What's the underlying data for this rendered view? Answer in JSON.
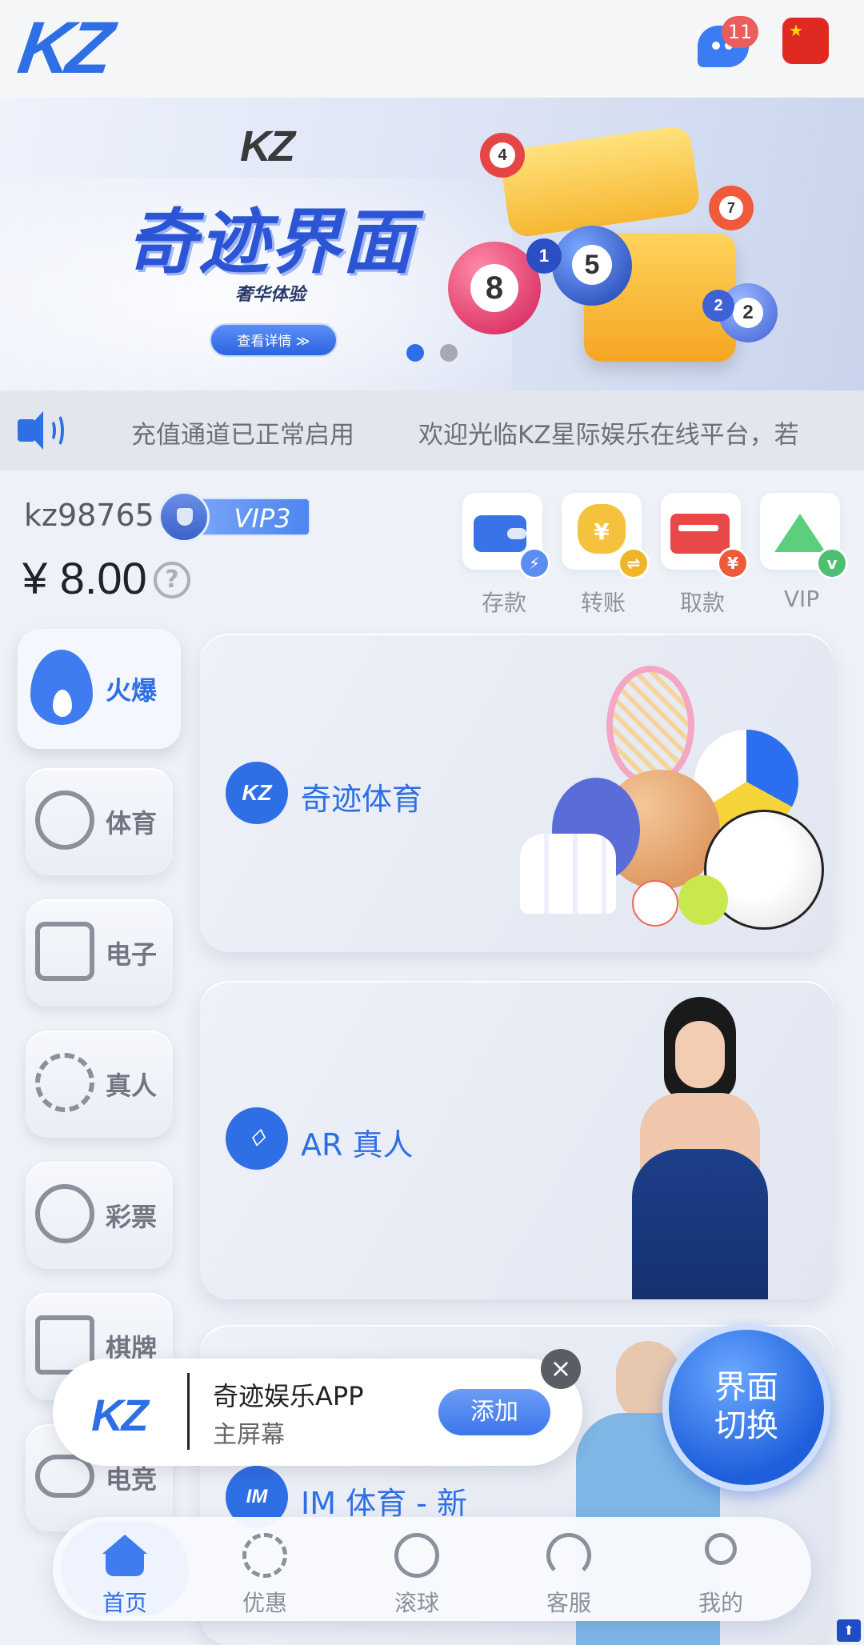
{
  "header": {
    "logo": "KZ",
    "message_count": "11",
    "language_flag": "china-flag-icon"
  },
  "banner": {
    "brand": "KZ",
    "title": "奇迹界面",
    "subtitle": "奢华体验",
    "button_label": "查看详情 ≫",
    "ball_numbers": [
      "4",
      "8",
      "5",
      "1",
      "2",
      "2",
      "7"
    ],
    "slides": 2,
    "active_slide": 1
  },
  "marquee": {
    "items": [
      "充值通道已正常启用",
      "欢迎光临KZ星际娱乐在线平台，若"
    ]
  },
  "account": {
    "username": "kz98765",
    "vip_level": "VIP3",
    "balance": "¥ 8.00",
    "help_icon": "?"
  },
  "quick_actions": [
    {
      "label": "存款",
      "icon": "wallet-icon"
    },
    {
      "label": "转账",
      "icon": "money-bag-icon"
    },
    {
      "label": "取款",
      "icon": "card-icon"
    },
    {
      "label": "VIP",
      "icon": "crown-icon"
    }
  ],
  "quick_action_marks": {
    "transfer_currency": "¥",
    "withdraw_currency": "¥",
    "transfer_swap": "⇌",
    "vip_letter": "v"
  },
  "categories": [
    {
      "label": "火爆",
      "icon": "flame-icon",
      "active": true
    },
    {
      "label": "体育",
      "icon": "soccer-ball-icon"
    },
    {
      "label": "电子",
      "icon": "slot-machine-icon"
    },
    {
      "label": "真人",
      "icon": "poker-chip-icon"
    },
    {
      "label": "彩票",
      "icon": "lottery-ball-icon"
    },
    {
      "label": "棋牌",
      "icon": "cards-icon"
    },
    {
      "label": "电竞",
      "icon": "gamepad-icon"
    }
  ],
  "games": [
    {
      "title": "奇迹体育",
      "icon_text": "KZ"
    },
    {
      "title": "AR 真人",
      "icon_text": "♢"
    },
    {
      "title": "IM 体育 - 新",
      "icon_text": "IM"
    }
  ],
  "switch_button": {
    "line1": "界面",
    "line2": "切换"
  },
  "install_popup": {
    "logo": "KZ",
    "title": "奇迹娱乐APP",
    "subtitle": "主屏幕",
    "add_label": "添加",
    "close": "×"
  },
  "bottom_nav": [
    {
      "label": "首页",
      "icon": "home-icon",
      "active": true
    },
    {
      "label": "优惠",
      "icon": "gift-badge-icon"
    },
    {
      "label": "滚球",
      "icon": "ball-icon"
    },
    {
      "label": "客服",
      "icon": "headset-icon"
    },
    {
      "label": "我的",
      "icon": "user-icon"
    }
  ],
  "colors": {
    "accent": "#2f6fe6",
    "badge": "#e95d5d",
    "background": "#eef1f7"
  }
}
